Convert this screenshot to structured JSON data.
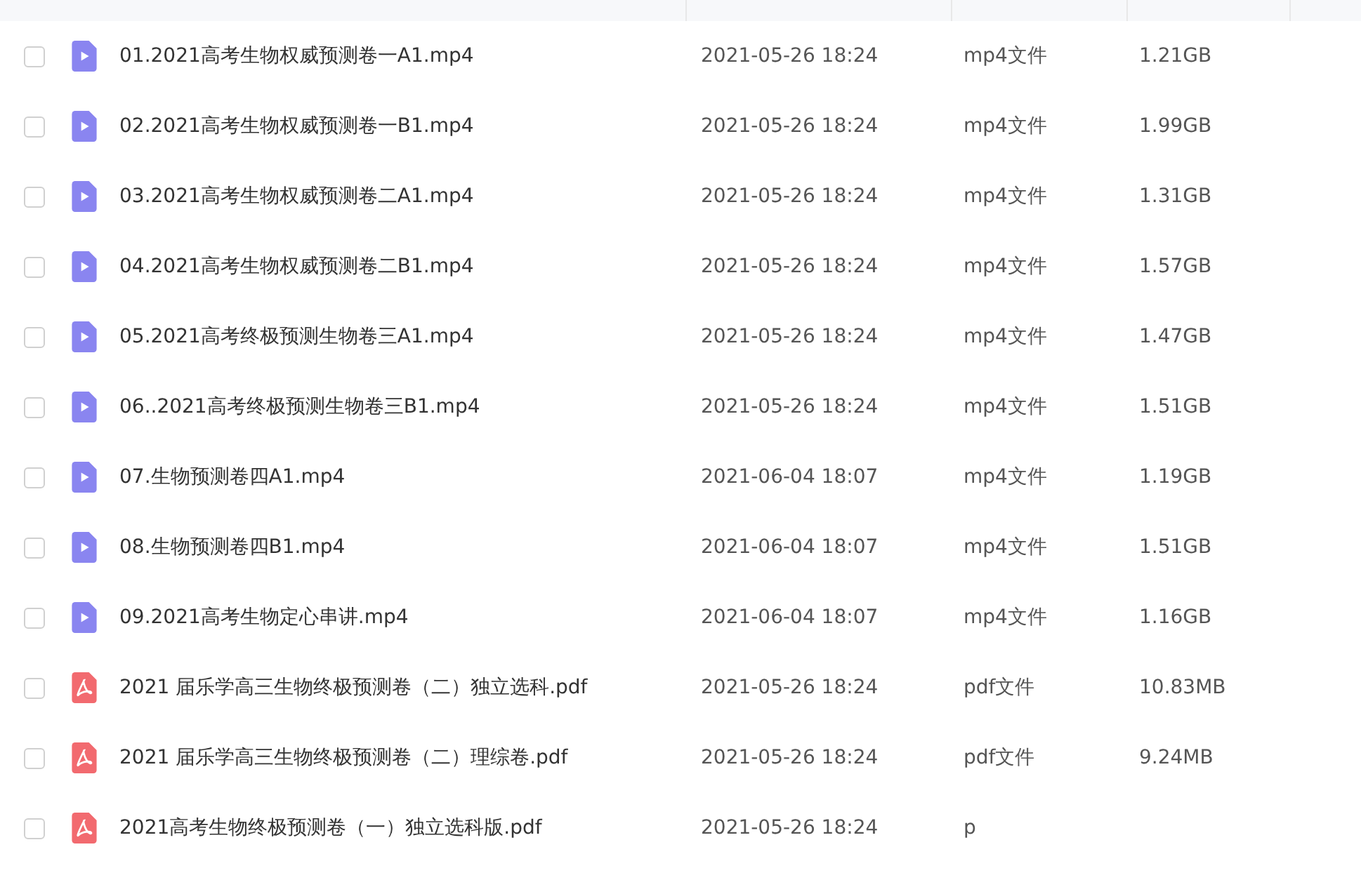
{
  "files": [
    {
      "kind": "video",
      "selected": false,
      "name": "01.2021高考生物权威预测卷一A1.mp4",
      "modified": "2021-05-26 18:24",
      "type": "mp4文件",
      "size": "1.21GB"
    },
    {
      "kind": "video",
      "selected": false,
      "name": "02.2021高考生物权威预测卷一B1.mp4",
      "modified": "2021-05-26 18:24",
      "type": "mp4文件",
      "size": "1.99GB"
    },
    {
      "kind": "video",
      "selected": false,
      "name": "03.2021高考生物权威预测卷二A1.mp4",
      "modified": "2021-05-26 18:24",
      "type": "mp4文件",
      "size": "1.31GB"
    },
    {
      "kind": "video",
      "selected": false,
      "name": "04.2021高考生物权威预测卷二B1.mp4",
      "modified": "2021-05-26 18:24",
      "type": "mp4文件",
      "size": "1.57GB"
    },
    {
      "kind": "video",
      "selected": false,
      "name": "05.2021高考终极预测生物卷三A1.mp4",
      "modified": "2021-05-26 18:24",
      "type": "mp4文件",
      "size": "1.47GB"
    },
    {
      "kind": "video",
      "selected": false,
      "name": "06..2021高考终极预测生物卷三B1.mp4",
      "modified": "2021-05-26 18:24",
      "type": "mp4文件",
      "size": "1.51GB"
    },
    {
      "kind": "video",
      "selected": false,
      "name": "07.生物预测卷四A1.mp4",
      "modified": "2021-06-04 18:07",
      "type": "mp4文件",
      "size": "1.19GB"
    },
    {
      "kind": "video",
      "selected": false,
      "name": "08.生物预测卷四B1.mp4",
      "modified": "2021-06-04 18:07",
      "type": "mp4文件",
      "size": "1.51GB"
    },
    {
      "kind": "video",
      "selected": false,
      "name": "09.2021高考生物定心串讲.mp4",
      "modified": "2021-06-04 18:07",
      "type": "mp4文件",
      "size": "1.16GB"
    },
    {
      "kind": "pdf",
      "selected": false,
      "name": "2021 届乐学高三生物终极预测卷（二）独立选科.pdf",
      "modified": "2021-05-26 18:24",
      "type": "pdf文件",
      "size": "10.83MB"
    },
    {
      "kind": "pdf",
      "selected": false,
      "name": "2021 届乐学高三生物终极预测卷（二）理综卷.pdf",
      "modified": "2021-05-26 18:24",
      "type": "pdf文件",
      "size": "9.24MB"
    },
    {
      "kind": "pdf",
      "selected": false,
      "name": "2021高考生物终极预测卷（一）独立选科版.pdf",
      "modified": "2021-05-26 18:24",
      "type": "p"
    }
  ]
}
